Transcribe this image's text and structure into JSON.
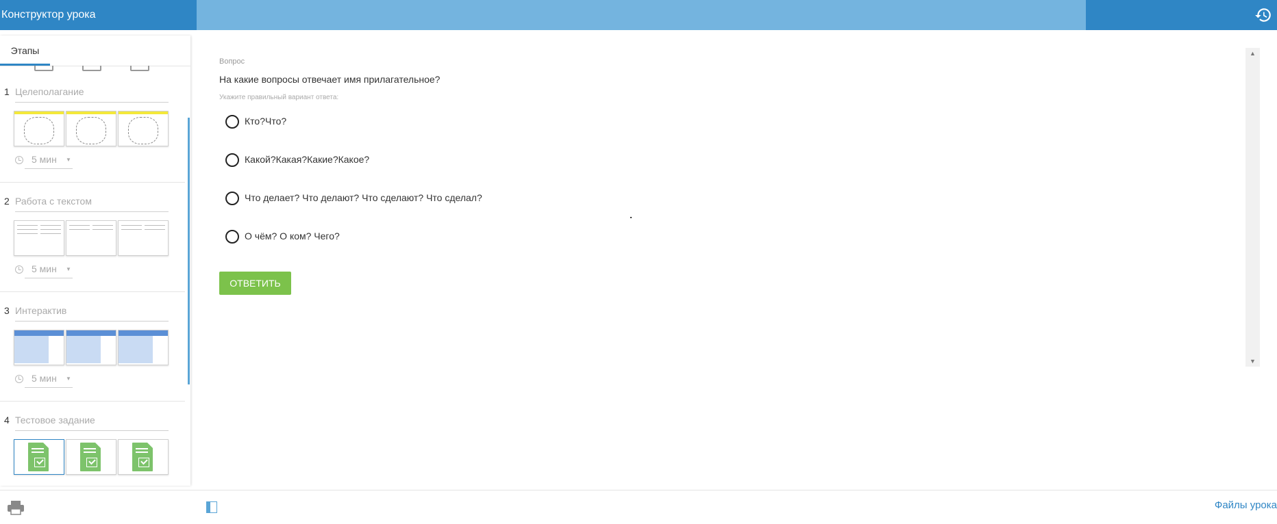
{
  "app": {
    "title": "Конструктор урока"
  },
  "sidebar": {
    "tab_label": "Этапы",
    "stages": [
      {
        "number": "1",
        "title": "Целеполагание",
        "time": "5 мин",
        "thumb_style": "sketch"
      },
      {
        "number": "2",
        "title": "Работа с текстом",
        "time": "5 мин",
        "thumb_style": "text"
      },
      {
        "number": "3",
        "title": "Интерактив",
        "time": "5 мин",
        "thumb_style": "table"
      },
      {
        "number": "4",
        "title": "Тестовое задание",
        "thumb_style": "test"
      }
    ]
  },
  "question": {
    "caption": "Вопрос",
    "text": "На какие вопросы отвечает имя прилагательное?",
    "hint": "Укажите правильный вариант ответа:",
    "options": [
      "Кто?Что?",
      "Какой?Какая?Какие?Какое?",
      "Что делает? Что делают? Что сделают? Что сделал?",
      "О чём? О ком? Чего?"
    ],
    "submit_label": "ОТВЕТИТЬ"
  },
  "footer": {
    "files_link": "Файлы урока"
  },
  "colors": {
    "header": "#2f86c5",
    "header_mid": "#74b4df",
    "accent_button": "#7cc24b",
    "link": "#2f86c5"
  }
}
